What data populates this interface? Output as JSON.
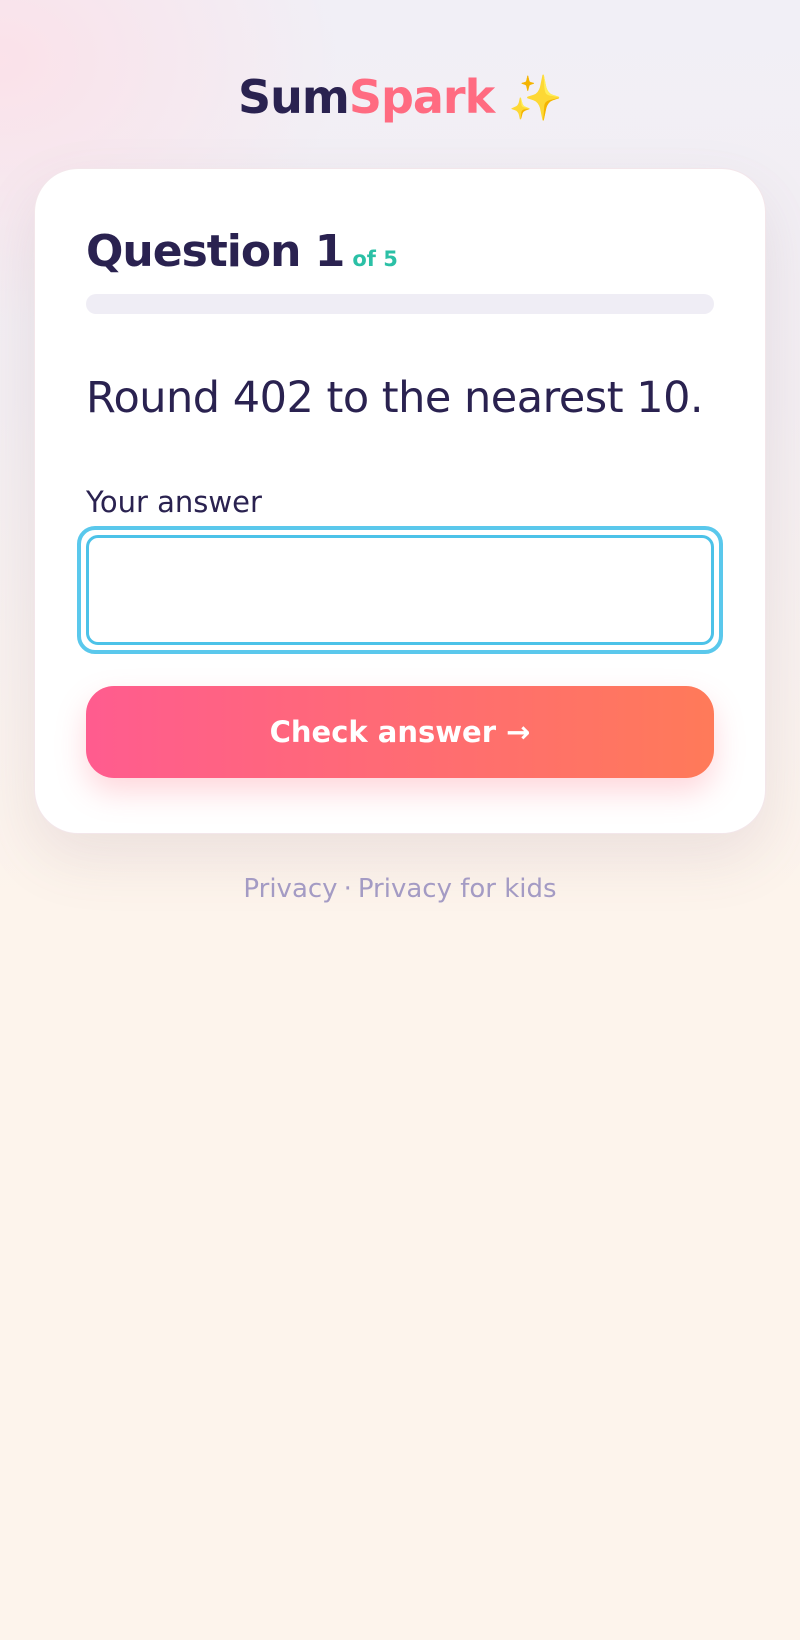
{
  "brand": {
    "part1": "Sum",
    "part2": "Spark",
    "icon": "sparkles-icon",
    "icon_glyph": "✨",
    "colors": {
      "dark": "#2a2250",
      "accent": "#ff6b81",
      "sparkle": "#f5b82e"
    }
  },
  "question": {
    "title": "Question 1",
    "of_label": "of 5",
    "progress": 0,
    "prompt": "Round 402 to the nearest 10."
  },
  "answer": {
    "label": "Your answer",
    "value": "",
    "placeholder": ""
  },
  "check_button": {
    "label": "Check answer",
    "arrow": "→"
  },
  "footer": {
    "link1": "Privacy",
    "separator": "·",
    "link2": "Privacy for kids"
  },
  "colors": {
    "text": "#2a2250",
    "teal": "#2bc0a6",
    "focus_ring": "#5ac8ec",
    "button_start": "#ff5c8f",
    "button_end": "#ff7a59",
    "footer_link": "#a49bc4"
  }
}
